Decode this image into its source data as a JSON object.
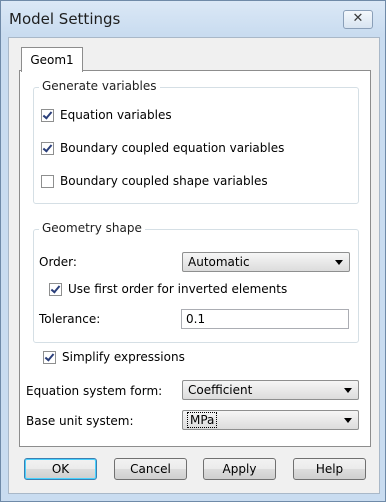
{
  "window": {
    "title": "Model Settings",
    "close_icon": "close-icon"
  },
  "tabs": [
    {
      "label": "Geom1",
      "selected": true
    }
  ],
  "generate_variables": {
    "label": "Generate variables",
    "items": [
      {
        "label": "Equation variables",
        "checked": true
      },
      {
        "label": "Boundary coupled equation variables",
        "checked": true
      },
      {
        "label": "Boundary coupled shape variables",
        "checked": false
      }
    ]
  },
  "geometry_shape": {
    "label": "Geometry shape",
    "order_label": "Order:",
    "order_value": "Automatic",
    "first_order_label": "Use first order for inverted elements",
    "first_order_checked": true,
    "tolerance_label": "Tolerance:",
    "tolerance_value": "0.1"
  },
  "simplify": {
    "label": "Simplify expressions",
    "checked": true
  },
  "equation_form": {
    "label": "Equation system form:",
    "value": "Coefficient"
  },
  "base_unit": {
    "label": "Base unit system:",
    "value": "MPa"
  },
  "buttons": {
    "ok": "OK",
    "cancel": "Cancel",
    "apply": "Apply",
    "help": "Help"
  }
}
